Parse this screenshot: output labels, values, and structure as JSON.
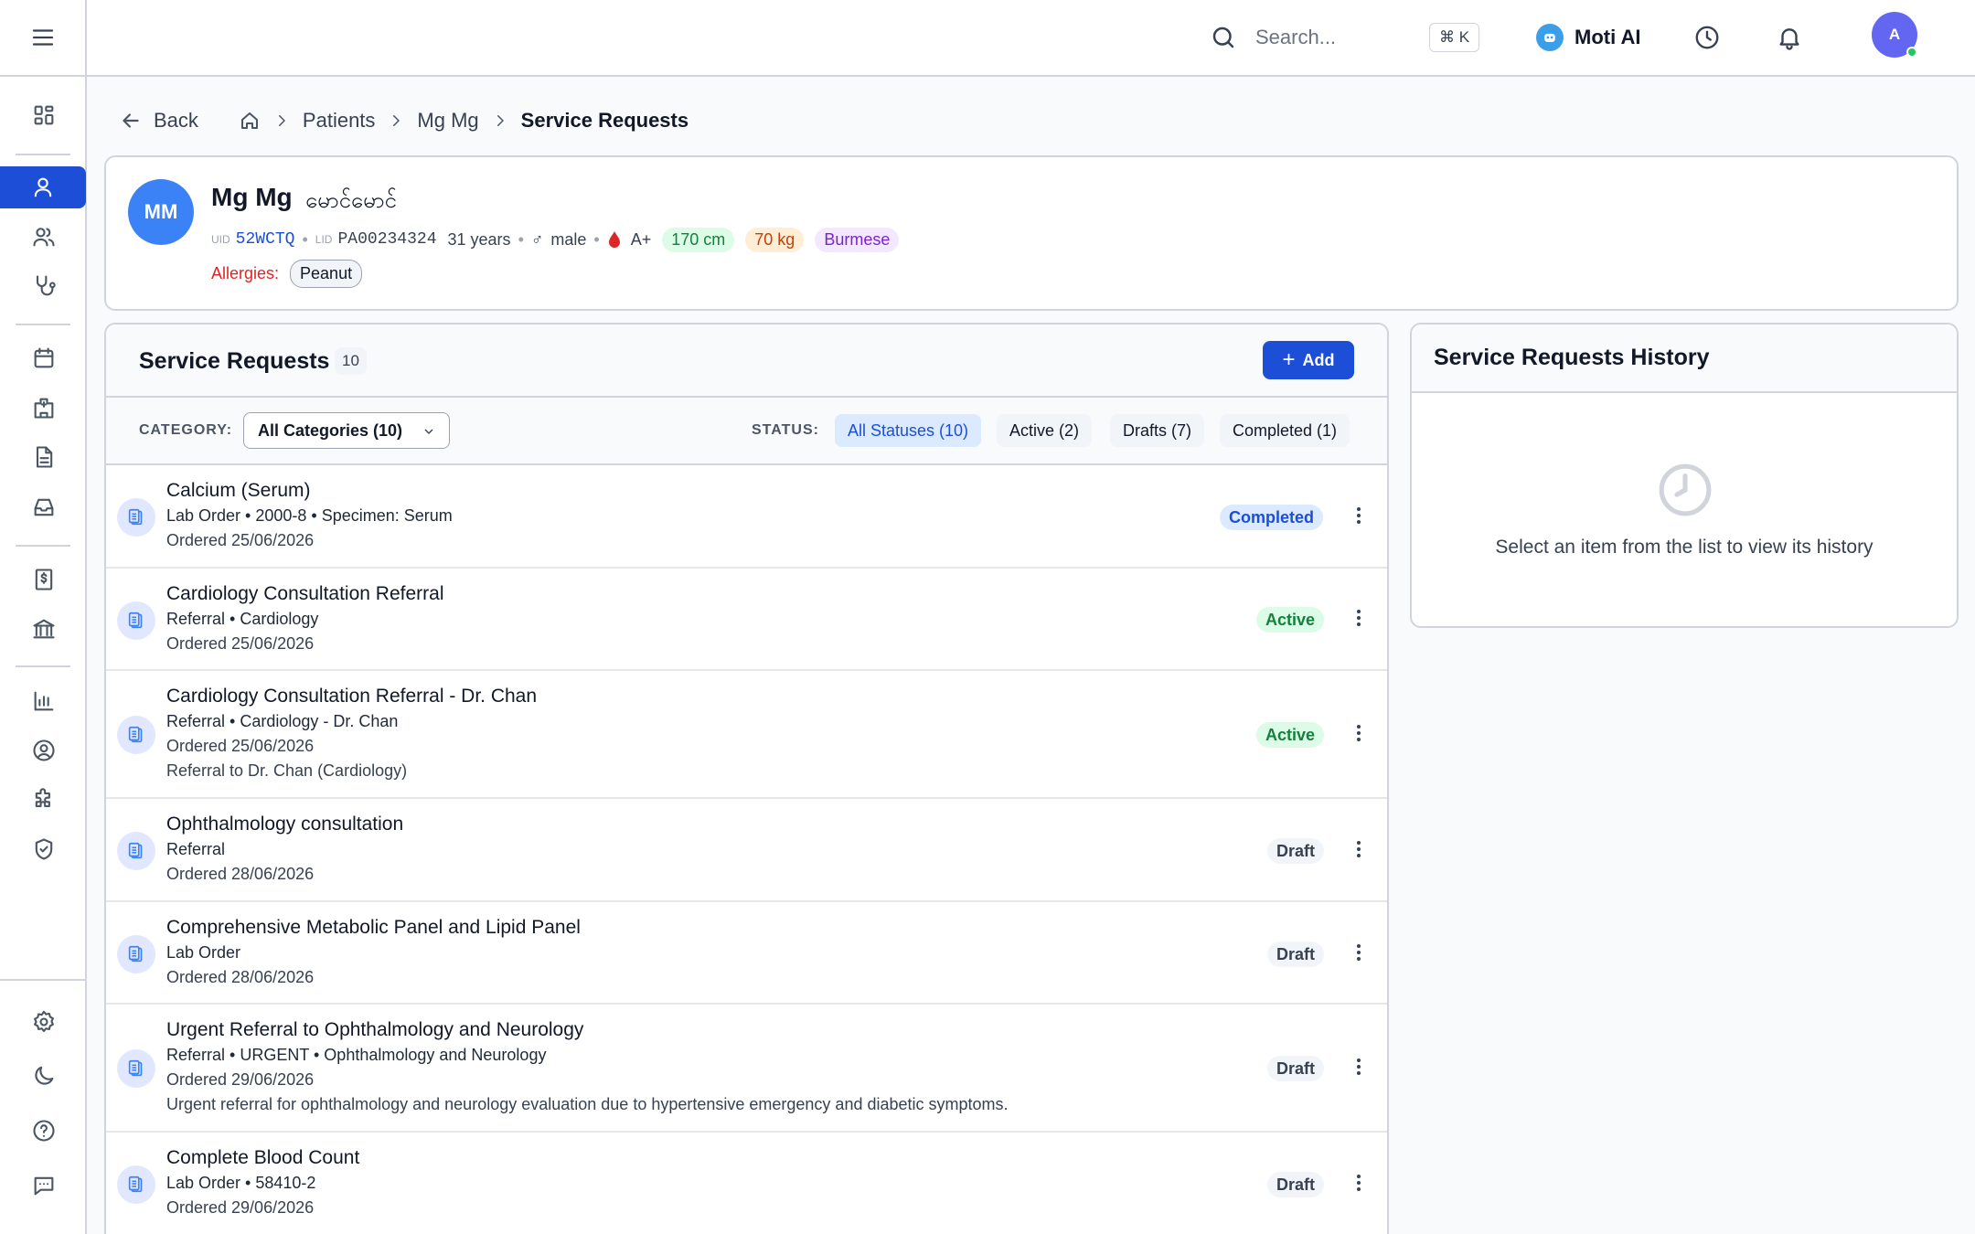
{
  "topbar": {
    "search_placeholder": "Search...",
    "shortcut": "⌘ K",
    "ai_label": "Moti AI",
    "avatar_initial": "A"
  },
  "breadcrumb": {
    "back": "Back",
    "items": [
      "Patients",
      "Mg Mg"
    ],
    "current": "Service Requests"
  },
  "patient": {
    "initials": "MM",
    "name": "Mg Mg",
    "native_name": "မောင်မောင်",
    "uid_label": "UID",
    "uid": "52WCTQ",
    "lid_label": "LID",
    "lid": "PA00234324",
    "age": "31 years",
    "gender_symbol": "♂",
    "gender": "male",
    "blood_type": "A+",
    "height": "170 cm",
    "weight": "70 kg",
    "language": "Burmese",
    "allergies_label": "Allergies:",
    "allergies": [
      "Peanut"
    ]
  },
  "service_requests": {
    "title": "Service Requests",
    "count": "10",
    "add_label": "Add",
    "category_label": "CATEGORY:",
    "category_value": "All Categories (10)",
    "status_label": "STATUS:",
    "status_filters": [
      "All Statuses (10)",
      "Active (2)",
      "Drafts (7)",
      "Completed (1)"
    ],
    "rows": [
      {
        "title": "Calcium (Serum)",
        "lines": [
          "Lab Order • 2000-8 • Specimen: Serum",
          "Ordered 25/06/2026"
        ],
        "status": "Completed"
      },
      {
        "title": "Cardiology Consultation Referral",
        "lines": [
          "Referral • Cardiology",
          "Ordered 25/06/2026"
        ],
        "status": "Active"
      },
      {
        "title": "Cardiology Consultation Referral - Dr. Chan",
        "lines": [
          "Referral • Cardiology - Dr. Chan",
          "Ordered 25/06/2026",
          "Referral to Dr. Chan (Cardiology)"
        ],
        "status": "Active"
      },
      {
        "title": "Ophthalmology consultation",
        "lines": [
          "Referral",
          "Ordered 28/06/2026"
        ],
        "status": "Draft"
      },
      {
        "title": "Comprehensive Metabolic Panel and Lipid Panel",
        "lines": [
          "Lab Order",
          "Ordered 28/06/2026"
        ],
        "status": "Draft"
      },
      {
        "title": "Urgent Referral to Ophthalmology and Neurology",
        "lines": [
          "Referral • URGENT • Ophthalmology and Neurology",
          "Ordered 29/06/2026",
          "Urgent referral for ophthalmology and neurology evaluation due to hypertensive emergency and diabetic symptoms."
        ],
        "status": "Draft"
      },
      {
        "title": "Complete Blood Count",
        "lines": [
          "Lab Order • 58410-2",
          "Ordered 29/06/2026"
        ],
        "status": "Draft"
      }
    ]
  },
  "history": {
    "title": "Service Requests History",
    "empty_text": "Select an item from the list to view its history"
  },
  "colors": {
    "primary": "#1d4ed8",
    "active_green": "#15803d",
    "allergy_red": "#dc2626"
  },
  "sidebar_icons": [
    "menu-icon",
    "dashboard-icon",
    "patient-icon",
    "users-icon",
    "stethoscope-icon",
    "calendar-icon",
    "hospital-icon",
    "document-icon",
    "inbox-icon",
    "billing-icon",
    "bank-icon",
    "chart-icon",
    "user-circle-icon",
    "puzzle-icon",
    "shield-icon",
    "settings-icon",
    "moon-icon",
    "help-icon",
    "chat-icon"
  ]
}
